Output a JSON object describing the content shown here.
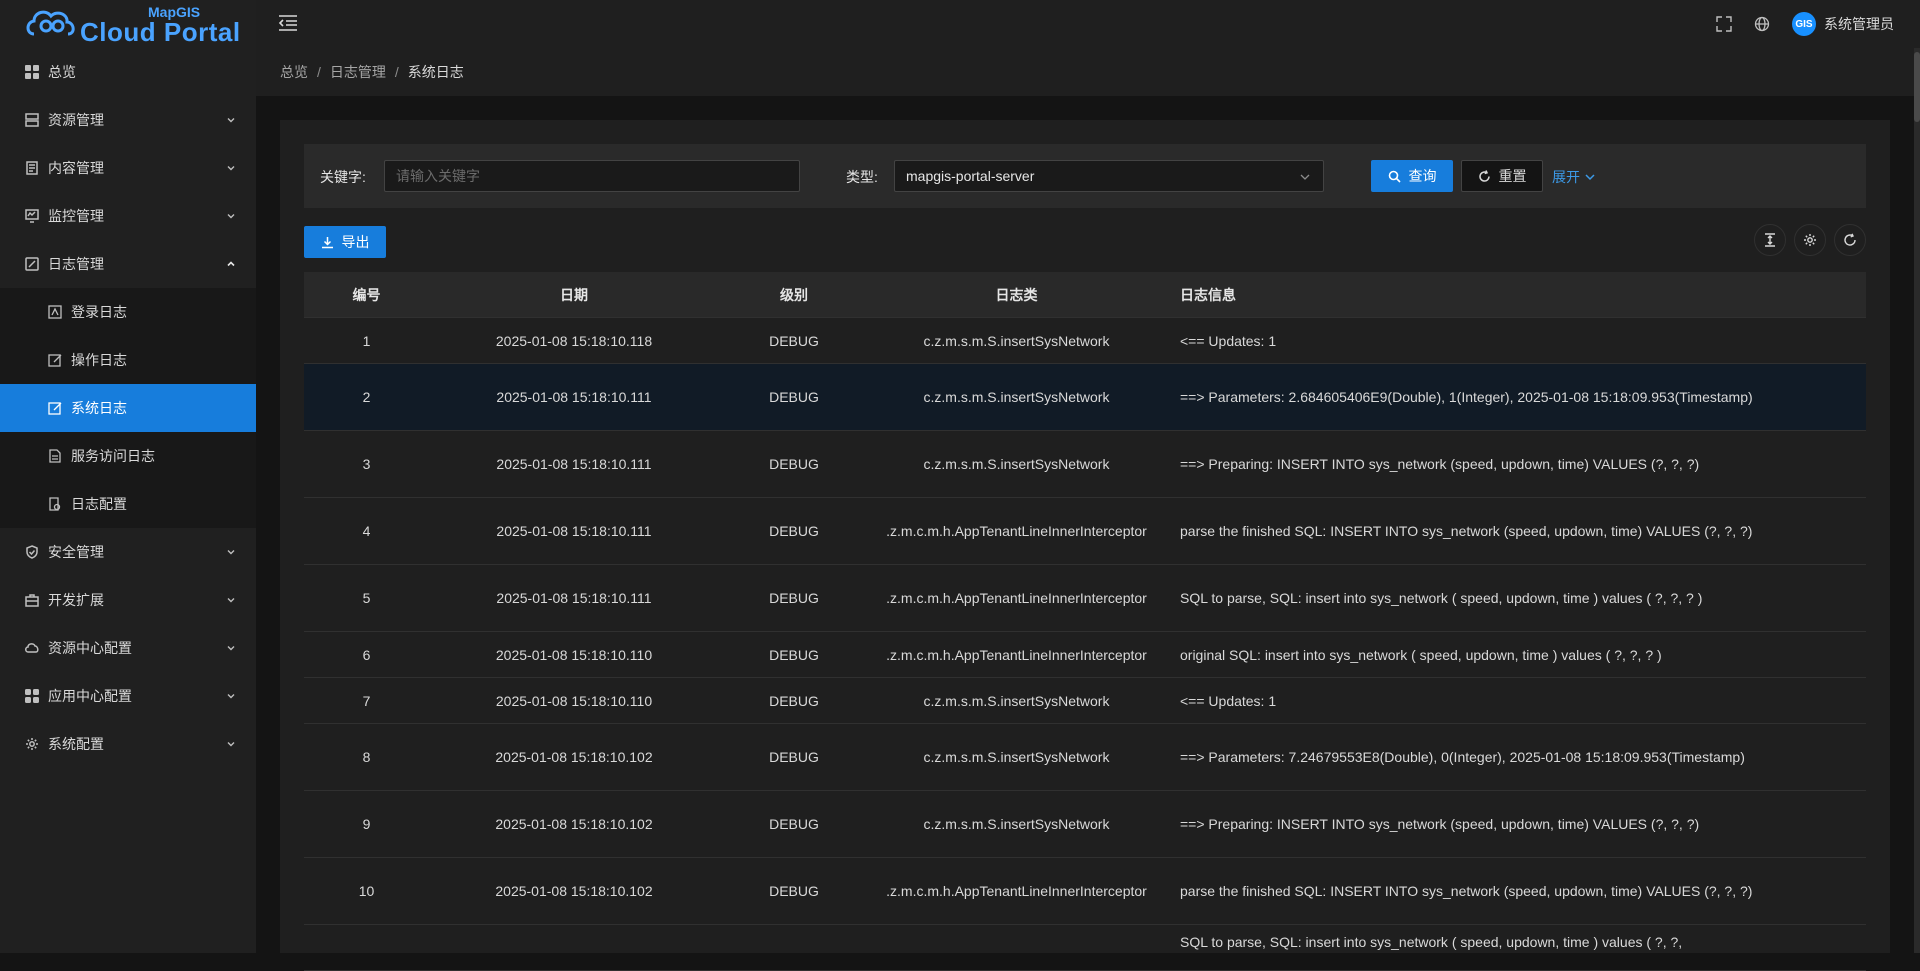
{
  "brand": {
    "top": "MapGIS",
    "main": "Cloud Portal",
    "colors": {
      "accent": "#177ddc",
      "link": "#3c9ae8"
    }
  },
  "sidebar": {
    "items": [
      {
        "label": "总览",
        "icon": "dashboard-icon"
      },
      {
        "label": "资源管理",
        "icon": "resource-icon"
      },
      {
        "label": "内容管理",
        "icon": "content-icon"
      },
      {
        "label": "监控管理",
        "icon": "monitor-icon"
      },
      {
        "label": "日志管理",
        "icon": "log-icon"
      },
      {
        "label": "安全管理",
        "icon": "shield-icon"
      },
      {
        "label": "开发扩展",
        "icon": "briefcase-icon"
      },
      {
        "label": "资源中心配置",
        "icon": "cloud-config-icon"
      },
      {
        "label": "应用中心配置",
        "icon": "apps-icon"
      },
      {
        "label": "系统配置",
        "icon": "gear-icon"
      }
    ],
    "log_sub": [
      {
        "label": "登录日志",
        "icon": "login-log-icon"
      },
      {
        "label": "操作日志",
        "icon": "edit-log-icon"
      },
      {
        "label": "系统日志",
        "icon": "system-log-icon"
      },
      {
        "label": "服务访问日志",
        "icon": "file-log-icon"
      },
      {
        "label": "日志配置",
        "icon": "log-config-icon"
      }
    ]
  },
  "header": {
    "username": "系统管理员",
    "avatar_text": "GIS"
  },
  "breadcrumb": [
    "总览",
    "日志管理",
    "系统日志"
  ],
  "search": {
    "keyword_label": "关键字:",
    "keyword_placeholder": "请输入关键字",
    "type_label": "类型:",
    "type_value": "mapgis-portal-server",
    "query_label": "查询",
    "reset_label": "重置",
    "expand_label": "展开"
  },
  "export_label": "导出",
  "table": {
    "columns": [
      "编号",
      "日期",
      "级别",
      "日志类",
      "日志信息"
    ],
    "rows": [
      {
        "no": "1",
        "date": "2025-01-08 15:18:10.118",
        "level": "DEBUG",
        "cls": "c.z.m.s.m.S.insertSysNetwork",
        "msg": "<== Updates: 1"
      },
      {
        "no": "2",
        "date": "2025-01-08 15:18:10.111",
        "level": "DEBUG",
        "cls": "c.z.m.s.m.S.insertSysNetwork",
        "msg": "==> Parameters: 2.684605406E9(Double), 1(Integer), 2025-01-08 15:18:09.953(Timestamp)"
      },
      {
        "no": "3",
        "date": "2025-01-08 15:18:10.111",
        "level": "DEBUG",
        "cls": "c.z.m.s.m.S.insertSysNetwork",
        "msg": "==> Preparing: INSERT INTO sys_network (speed, updown, time) VALUES (?, ?, ?)"
      },
      {
        "no": "4",
        "date": "2025-01-08 15:18:10.111",
        "level": "DEBUG",
        "cls": ".z.m.c.m.h.AppTenantLineInnerInterceptor",
        "msg": "parse the finished SQL: INSERT INTO sys_network (speed, updown, time) VALUES (?, ?, ?)"
      },
      {
        "no": "5",
        "date": "2025-01-08 15:18:10.111",
        "level": "DEBUG",
        "cls": ".z.m.c.m.h.AppTenantLineInnerInterceptor",
        "msg": "SQL to parse, SQL: insert into sys_network ( speed, updown, time ) values ( ?, ?, ? )"
      },
      {
        "no": "6",
        "date": "2025-01-08 15:18:10.110",
        "level": "DEBUG",
        "cls": ".z.m.c.m.h.AppTenantLineInnerInterceptor",
        "msg": "original SQL: insert into sys_network ( speed, updown, time ) values ( ?, ?, ? )"
      },
      {
        "no": "7",
        "date": "2025-01-08 15:18:10.110",
        "level": "DEBUG",
        "cls": "c.z.m.s.m.S.insertSysNetwork",
        "msg": "<== Updates: 1"
      },
      {
        "no": "8",
        "date": "2025-01-08 15:18:10.102",
        "level": "DEBUG",
        "cls": "c.z.m.s.m.S.insertSysNetwork",
        "msg": "==> Parameters: 7.24679553E8(Double), 0(Integer), 2025-01-08 15:18:09.953(Timestamp)"
      },
      {
        "no": "9",
        "date": "2025-01-08 15:18:10.102",
        "level": "DEBUG",
        "cls": "c.z.m.s.m.S.insertSysNetwork",
        "msg": "==> Preparing: INSERT INTO sys_network (speed, updown, time) VALUES (?, ?, ?)"
      },
      {
        "no": "10",
        "date": "2025-01-08 15:18:10.102",
        "level": "DEBUG",
        "cls": ".z.m.c.m.h.AppTenantLineInnerInterceptor",
        "msg": "parse the finished SQL: INSERT INTO sys_network (speed, updown, time) VALUES (?, ?, ?)"
      },
      {
        "no": "",
        "date": "",
        "level": "",
        "cls": "",
        "msg": "SQL to parse, SQL: insert into sys_network ( speed, updown, time ) values ( ?, ?,"
      }
    ]
  }
}
